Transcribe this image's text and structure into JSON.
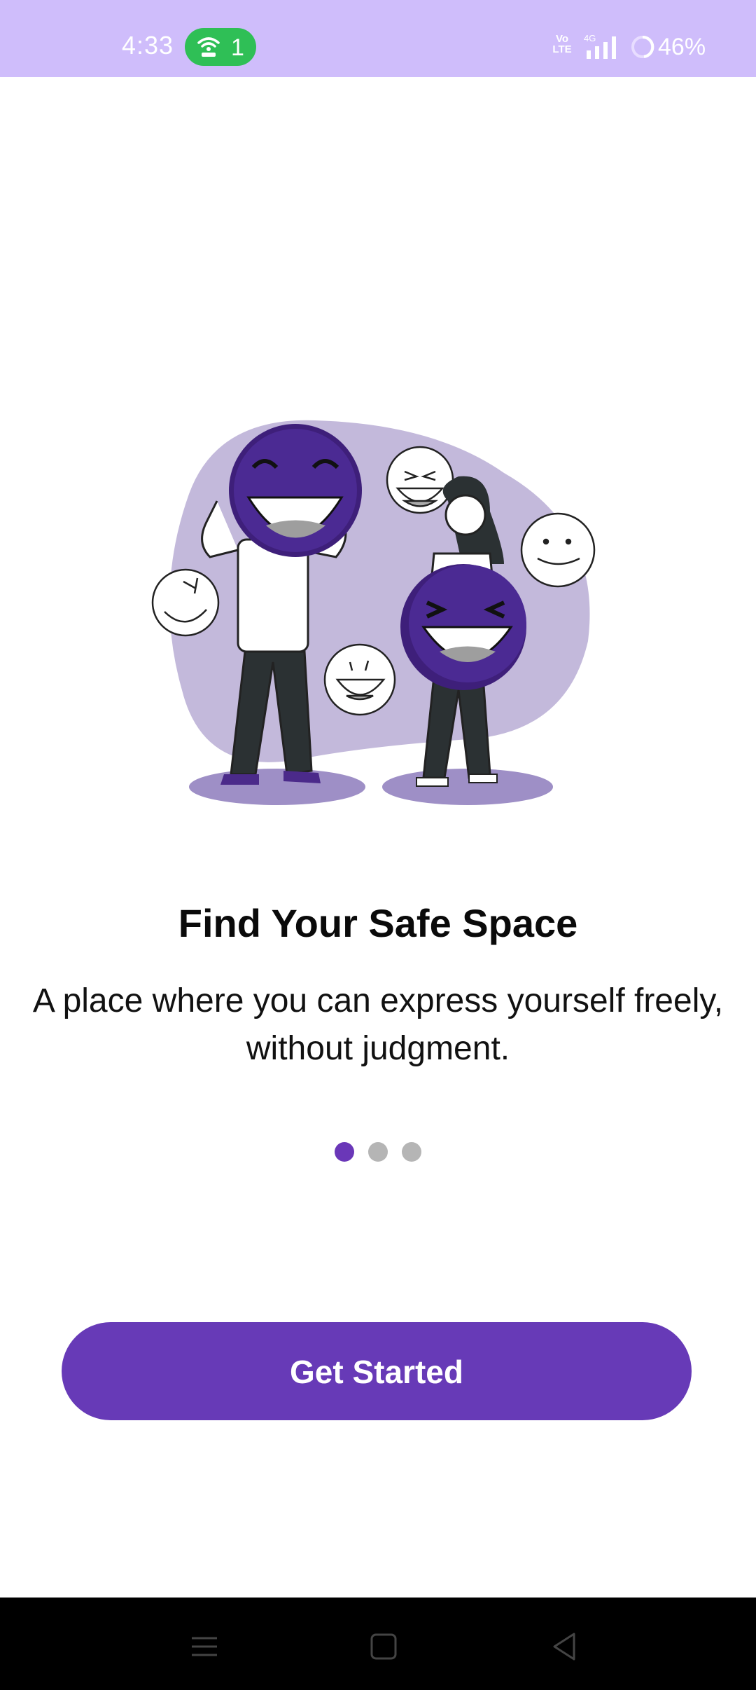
{
  "status_bar": {
    "time": "4:33",
    "hotspot_count": "1",
    "network_label": "Vo\nLTE",
    "network_type": "4G",
    "battery": "46%",
    "icons": [
      "hotspot-icon",
      "volte-icon",
      "signal-icon",
      "battery-icon"
    ]
  },
  "onboarding": {
    "title": "Find Your Safe Space",
    "subtitle": "A place where you can express yourself freely, without judgment.",
    "page_indicator": {
      "total": 3,
      "active": 1
    },
    "cta_label": "Get Started"
  },
  "colors": {
    "accent": "#673ab7",
    "status_bar": "#cfbdfb",
    "illustration_blob": "#c3b9db",
    "dot_inactive": "#b5b5b5"
  },
  "nav": {
    "icons": [
      "menu-icon",
      "home-icon",
      "back-icon"
    ]
  }
}
